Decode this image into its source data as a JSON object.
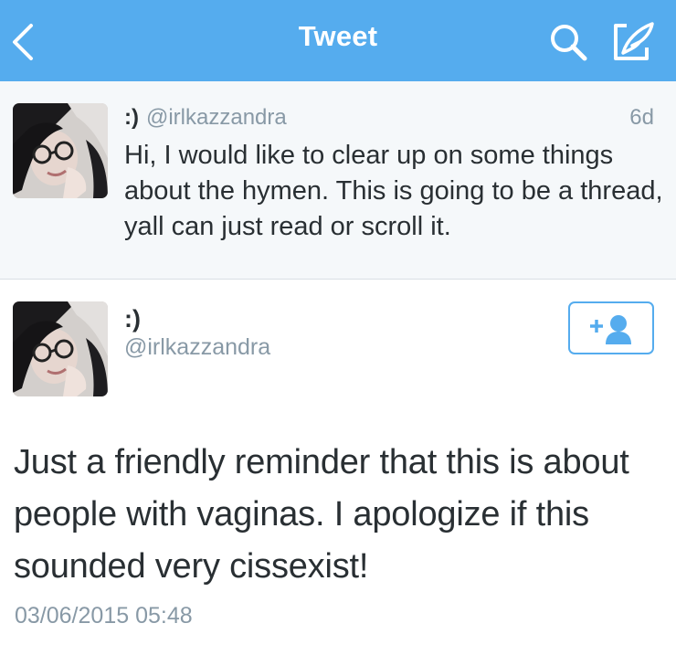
{
  "header": {
    "title": "Tweet",
    "background_color": "#55acee",
    "icons": {
      "back": "chevron-left-icon",
      "search": "search-icon",
      "compose": "compose-tweet-icon"
    }
  },
  "parent_tweet": {
    "display_name": ":)",
    "handle": "@irlkazzandra",
    "time": "6d",
    "text": "Hi, I would like to clear up on some things about the hymen. This is going to be a thread, yall can just read or scroll it."
  },
  "main_tweet": {
    "display_name": ":)",
    "handle": "@irlkazzandra",
    "follow_icon": "add-user-icon",
    "text": "Just a friendly reminder that this is about people with vaginas. I apologize if this sounded very cissexist!",
    "timestamp": "03/06/2015 05:48"
  }
}
